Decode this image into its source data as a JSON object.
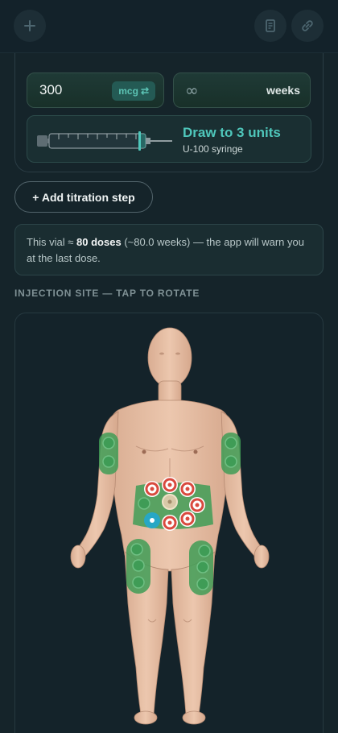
{
  "topbar": {
    "left_icon": "plus-icon",
    "right_icons": [
      "document-icon",
      "link-icon"
    ]
  },
  "dose": {
    "amount": "300",
    "unit": "mcg",
    "unit_icon": "swap-icon",
    "duration": "∞",
    "duration_unit": "weeks"
  },
  "syringe": {
    "title": "Draw to 3 units",
    "subtitle": "U-100 syringe",
    "fill_units": 3
  },
  "titration_button": "+ Add titration step",
  "info": {
    "prefix": "This vial ≈ ",
    "doses": "80 doses",
    "suffix": " (~80.0 weeks) — the app will warn you at the last dose."
  },
  "injection_site": {
    "label": "INJECTION SITE — TAP TO ROTATE",
    "selected_site": "abdomen-left-lower",
    "colors": {
      "available": "#3f9c56",
      "used": "#d94a3f",
      "selected": "#27a7c4"
    }
  }
}
